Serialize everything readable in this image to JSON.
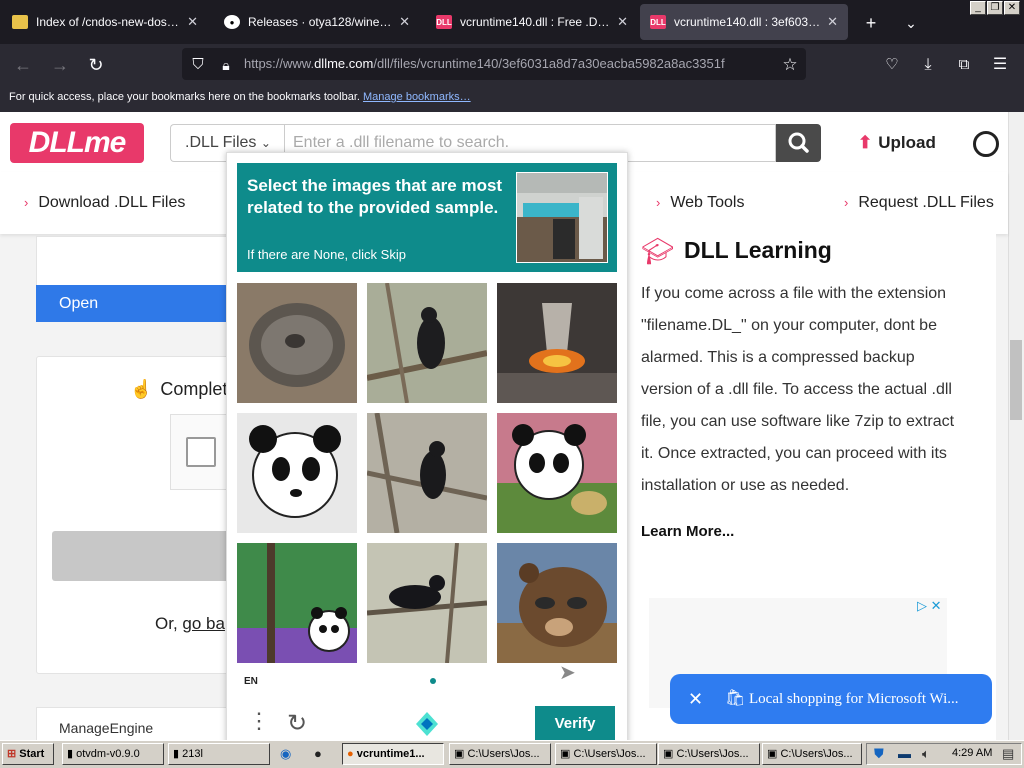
{
  "browser": {
    "tabs": [
      {
        "title": "Index of /cndos-new-dos-16-ye",
        "favicon": "folder-icon"
      },
      {
        "title": "Releases · otya128/winevdm",
        "favicon": "github-icon"
      },
      {
        "title": "vcruntime140.dll : Free .DLL do",
        "favicon": "dll-icon"
      },
      {
        "title": "vcruntime140.dll : 3ef6031a8d7",
        "favicon": "dll-icon"
      }
    ],
    "active_tab": 3,
    "url_prefix": "https://www.",
    "url_domain": "dllme.com",
    "url_path": "/dll/files/vcruntime140/3ef6031a8d7a30eacba5982a8ac3351f",
    "bookmarks_text": "For quick access, place your bookmarks here on the bookmarks toolbar.",
    "bookmarks_link": "Manage bookmarks…"
  },
  "site": {
    "logo": "DLLme",
    "search_dropdown": ".DLL Files",
    "search_placeholder": "Enter a .dll filename to search.",
    "upload": "Upload",
    "menu": [
      "Download .DLL Files",
      "Web Tools",
      "Request .DLL Files"
    ],
    "open_button": "Open",
    "complete_label": "Complet",
    "or_text": "Or,",
    "or_link": "go ba",
    "manage_label": "ManageEngine",
    "learning": {
      "title": "DLL Learning",
      "lines": [
        "If you come across a file with the extension",
        "\"filename.DL_\" on your computer, dont be",
        "alarmed. This is a compressed backup",
        "version of a .dll file. To access the actual .dll",
        "file, you can use software like 7zip to extract",
        "it. Once extracted, you can proceed with its",
        "installation or use as needed."
      ],
      "learn_more": "Learn More..."
    },
    "toast": "Local shopping for Microsoft Wi..."
  },
  "captcha": {
    "prompt": "Select the images that are most related to the provided sample.",
    "skip_hint": "If there are None, click Skip",
    "images": [
      "frying-pan",
      "crow",
      "gas-burner",
      "panda",
      "crow",
      "panda",
      "panda",
      "crow",
      "bear"
    ],
    "lang": "EN",
    "verify": "Verify"
  },
  "taskbar": {
    "start": "Start",
    "items": [
      "otvdm-v0.9.0",
      "213l",
      "vcruntime1...",
      "C:\\Users\\Jos...",
      "C:\\Users\\Jos...",
      "C:\\Users\\Jos...",
      "C:\\Users\\Jos..."
    ],
    "clock": "4:29 AM"
  }
}
